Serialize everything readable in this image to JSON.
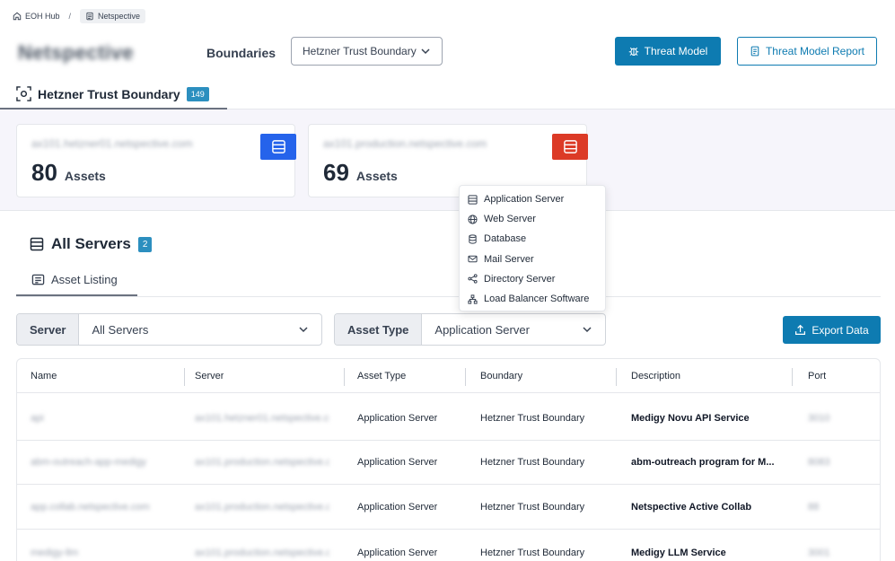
{
  "breadcrumb": {
    "home": "EOH Hub",
    "separator": "/",
    "current": "Netspective"
  },
  "header": {
    "app_name": "Netspective",
    "boundaries_label": "Boundaries",
    "boundary_select": "Hetzner Trust Boundary",
    "threat_model_button": "Threat Model",
    "threat_model_report_button": "Threat Model Report"
  },
  "boundary_tab": {
    "label": "Hetzner Trust Boundary",
    "count": "149"
  },
  "cards": [
    {
      "host": "ax101.hetzner01.netspective.com",
      "count": "80",
      "assets_label": "Assets",
      "icon_color": "#2563eb"
    },
    {
      "host": "ax101.production.netspective.com",
      "count": "69",
      "assets_label": "Assets",
      "icon_color": "#dc3a26"
    }
  ],
  "servers": {
    "title": "All Servers",
    "count": "2",
    "tab": "Asset Listing"
  },
  "filters": {
    "server_label": "Server",
    "server_value": "All Servers",
    "asset_type_label": "Asset Type",
    "asset_type_value": "Application Server"
  },
  "export_button": "Export Data",
  "table": {
    "headers": [
      "Name",
      "Server",
      "Asset Type",
      "Boundary",
      "Description",
      "Port"
    ],
    "rows": [
      {
        "name": "api",
        "server": "ax101.hetzner01.netspective.com",
        "asset_type": "Application Server",
        "boundary": "Hetzner Trust Boundary",
        "description": "Medigy Novu API Service",
        "port": "3010"
      },
      {
        "name": "abm-outreach-app-medigy",
        "server": "ax101.production.netspective.com",
        "asset_type": "Application Server",
        "boundary": "Hetzner Trust Boundary",
        "description": "abm-outreach program for M...",
        "port": "8083"
      },
      {
        "name": "app.collab.netspective.com",
        "server": "ax101.production.netspective.com",
        "asset_type": "Application Server",
        "boundary": "Hetzner Trust Boundary",
        "description": "Netspective Active Collab",
        "port": "88"
      },
      {
        "name": "medigy-llm",
        "server": "ax101.production.netspective.com",
        "asset_type": "Application Server",
        "boundary": "Hetzner Trust Boundary",
        "description": "Medigy LLM Service",
        "port": "3001"
      }
    ]
  },
  "asset_type_menu": {
    "items": [
      {
        "label": "Application Server",
        "icon": "server-icon"
      },
      {
        "label": "Web Server",
        "icon": "globe-icon"
      },
      {
        "label": "Database",
        "icon": "database-icon"
      },
      {
        "label": "Mail Server",
        "icon": "mail-icon"
      },
      {
        "label": "Directory Server",
        "icon": "share-nodes-icon"
      },
      {
        "label": "Load Balancer Software",
        "icon": "network-icon"
      }
    ]
  },
  "colors": {
    "primary": "#0e7bb1",
    "badge": "#2c8fbf",
    "band": "#f6f5fb"
  }
}
